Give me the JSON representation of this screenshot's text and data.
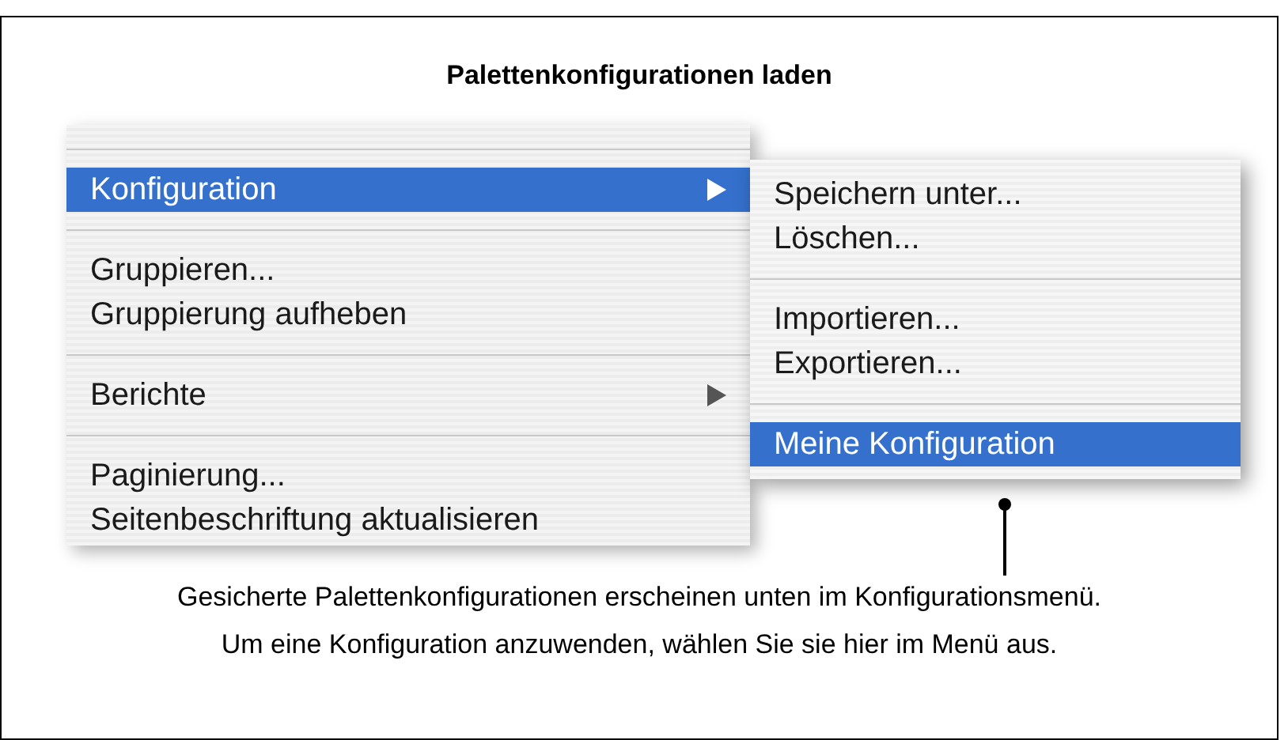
{
  "title": "Palettenkonfigurationen laden",
  "menu": {
    "items": [
      {
        "kind": "separator"
      },
      {
        "kind": "item",
        "label": "Konfiguration",
        "selected": true,
        "submenu": true
      },
      {
        "kind": "separator"
      },
      {
        "kind": "item",
        "label": "Gruppieren...",
        "selected": false,
        "submenu": false
      },
      {
        "kind": "item",
        "label": "Gruppierung aufheben",
        "selected": false,
        "submenu": false
      },
      {
        "kind": "separator"
      },
      {
        "kind": "item",
        "label": "Berichte",
        "selected": false,
        "submenu": true
      },
      {
        "kind": "separator"
      },
      {
        "kind": "item",
        "label": "Paginierung...",
        "selected": false,
        "submenu": false
      },
      {
        "kind": "item",
        "label": "Seitenbeschriftung aktualisieren",
        "selected": false,
        "submenu": false
      }
    ]
  },
  "submenu": {
    "items": [
      {
        "kind": "item",
        "label": "Speichern unter...",
        "selected": false
      },
      {
        "kind": "item",
        "label": "Löschen...",
        "selected": false
      },
      {
        "kind": "separator"
      },
      {
        "kind": "item",
        "label": "Importieren...",
        "selected": false
      },
      {
        "kind": "item",
        "label": "Exportieren...",
        "selected": false
      },
      {
        "kind": "separator"
      },
      {
        "kind": "item",
        "label": "Meine Konfiguration",
        "selected": true
      }
    ]
  },
  "caption": [
    "Gesicherte Palettenkonfigurationen erscheinen unten im Konfigurationsmenü.",
    "Um eine Konfiguration anzuwenden, wählen Sie sie hier im Menü aus."
  ]
}
